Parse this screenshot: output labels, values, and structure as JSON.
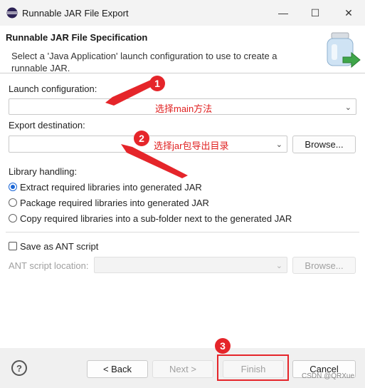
{
  "window": {
    "title": "Runnable JAR File Export",
    "minimize_glyph": "—",
    "maximize_glyph": "☐",
    "close_glyph": "✕"
  },
  "header": {
    "title": "Runnable JAR File Specification",
    "description": "Select a 'Java Application' launch configuration to use to create a runnable JAR."
  },
  "launch": {
    "label": "Launch configuration:",
    "value": ""
  },
  "export": {
    "label": "Export destination:",
    "value": "",
    "browse_label": "Browse..."
  },
  "library": {
    "label": "Library handling:",
    "options": [
      {
        "label": "Extract required libraries into generated JAR",
        "selected": true
      },
      {
        "label": "Package required libraries into generated JAR",
        "selected": false
      },
      {
        "label": "Copy required libraries into a sub-folder next to the generated JAR",
        "selected": false
      }
    ]
  },
  "ant": {
    "checkbox_label": "Save as ANT script",
    "checked": false,
    "location_label": "ANT script location:",
    "browse_label": "Browse..."
  },
  "footer": {
    "help_glyph": "?",
    "back_label": "< Back",
    "next_label": "Next >",
    "finish_label": "Finish",
    "cancel_label": "Cancel",
    "watermark": "CSDN @QRXue"
  },
  "annotations": {
    "badge1": "1",
    "text1": "选择main方法",
    "badge2": "2",
    "text2": "选择jar包导出目录",
    "badge3": "3",
    "color": "#e02020"
  },
  "icons": {
    "app": "eclipse-icon",
    "wizard": "jar-export-icon"
  }
}
